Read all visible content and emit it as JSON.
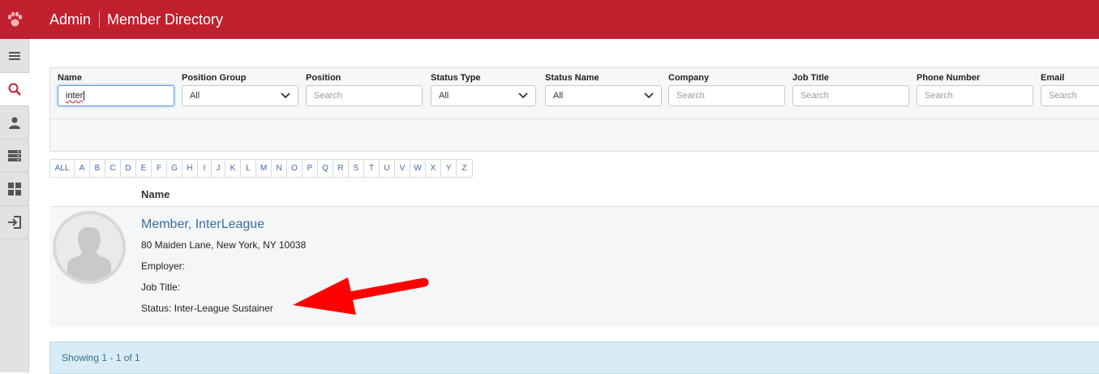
{
  "header": {
    "section": "Admin",
    "title": "Member Directory",
    "color": "#c0202e"
  },
  "sidebar": {
    "items": [
      {
        "icon": "menu-icon"
      },
      {
        "icon": "search-icon",
        "active": true
      },
      {
        "icon": "user-icon"
      },
      {
        "icon": "server-icon"
      },
      {
        "icon": "dashboard-icon"
      },
      {
        "icon": "sign-in-icon"
      }
    ]
  },
  "filters": {
    "name": {
      "label": "Name",
      "value": "inter"
    },
    "position_group": {
      "label": "Position Group",
      "value": "All"
    },
    "position": {
      "label": "Position",
      "placeholder": "Search"
    },
    "status_type": {
      "label": "Status Type",
      "value": "All"
    },
    "status_name": {
      "label": "Status Name",
      "value": "All"
    },
    "company": {
      "label": "Company",
      "placeholder": "Search"
    },
    "job_title": {
      "label": "Job Title",
      "placeholder": "Search"
    },
    "phone_number": {
      "label": "Phone Number",
      "placeholder": "Search"
    },
    "email": {
      "label": "Email",
      "placeholder": "Search"
    }
  },
  "alphabet": [
    "ALL",
    "A",
    "B",
    "C",
    "D",
    "E",
    "F",
    "G",
    "H",
    "I",
    "J",
    "K",
    "L",
    "M",
    "N",
    "O",
    "P",
    "Q",
    "R",
    "S",
    "T",
    "U",
    "V",
    "W",
    "X",
    "Y",
    "Z"
  ],
  "results": {
    "column_header": "Name",
    "members": [
      {
        "name": "Member, InterLeague",
        "address": "80 Maiden Lane, New York, NY 10038",
        "employer": "Employer:",
        "job_title": "Job Title:",
        "status": "Status: Inter-League Sustainer"
      }
    ],
    "showing": "Showing 1 - 1 of 1"
  },
  "annotation": {
    "color": "#ff0000"
  }
}
